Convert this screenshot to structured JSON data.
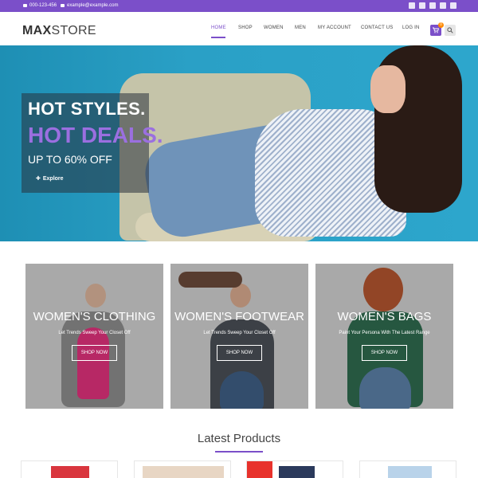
{
  "topbar": {
    "phone": "000-123-456",
    "email": "example@example.com",
    "socials": [
      "twitter-icon",
      "facebook-icon",
      "flickr-icon",
      "youtube-icon",
      "instagram-icon"
    ]
  },
  "header": {
    "logo_bold": "MAX",
    "logo_rest": "STORE",
    "nav": [
      "HOME",
      "SHOP",
      "WOMEN",
      "MEN",
      "MY ACCOUNT",
      "CONTACT US",
      "LOG IN"
    ],
    "active_nav": "HOME",
    "cart_count": "0"
  },
  "hero": {
    "line1": "HOT STYLES.",
    "line2": "HOT DEALS.",
    "line3": "UP TO 60% OFF",
    "button": "Explore"
  },
  "categories": [
    {
      "title": "WOMEN'S CLOTHING",
      "subtitle": "Let Trends Sweep Your Closet Off",
      "button": "SHOP NOW"
    },
    {
      "title": "WOMEN'S FOOTWEAR",
      "subtitle": "Let Trends Sweep Your Closet Off",
      "button": "SHOP NOW"
    },
    {
      "title": "WOMEN'S BAGS",
      "subtitle": "Paint Your Persona With The Latest Range",
      "button": "SHOP NOW"
    }
  ],
  "latest": {
    "title": "Latest Products"
  },
  "colors": {
    "accent": "#7b4fc9",
    "topbar": "#7b4fc9",
    "hero_bg": "#2aa0c6",
    "cart_badge": "#ff8a00"
  }
}
